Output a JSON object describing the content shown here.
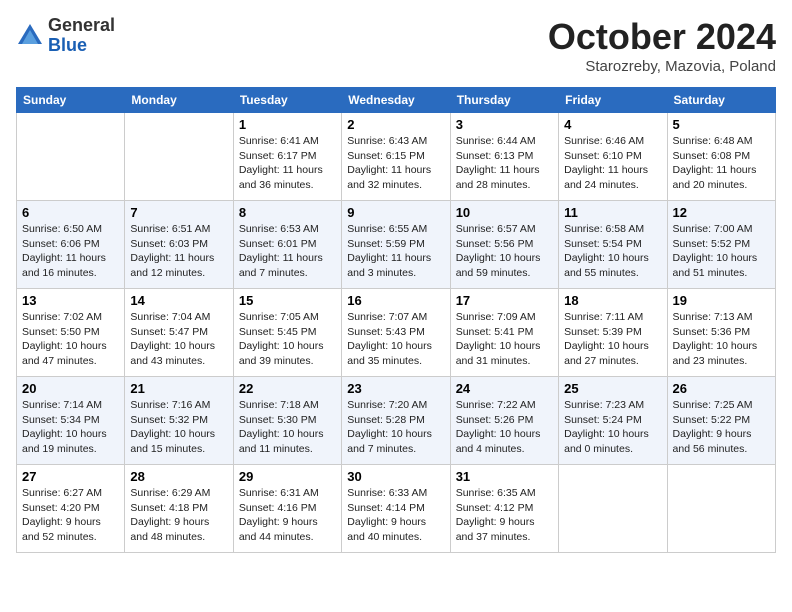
{
  "header": {
    "logo_general": "General",
    "logo_blue": "Blue",
    "title": "October 2024",
    "location": "Starozreby, Mazovia, Poland"
  },
  "days_of_week": [
    "Sunday",
    "Monday",
    "Tuesday",
    "Wednesday",
    "Thursday",
    "Friday",
    "Saturday"
  ],
  "weeks": [
    [
      {
        "day": "",
        "info": ""
      },
      {
        "day": "",
        "info": ""
      },
      {
        "day": "1",
        "info": "Sunrise: 6:41 AM\nSunset: 6:17 PM\nDaylight: 11 hours\nand 36 minutes."
      },
      {
        "day": "2",
        "info": "Sunrise: 6:43 AM\nSunset: 6:15 PM\nDaylight: 11 hours\nand 32 minutes."
      },
      {
        "day": "3",
        "info": "Sunrise: 6:44 AM\nSunset: 6:13 PM\nDaylight: 11 hours\nand 28 minutes."
      },
      {
        "day": "4",
        "info": "Sunrise: 6:46 AM\nSunset: 6:10 PM\nDaylight: 11 hours\nand 24 minutes."
      },
      {
        "day": "5",
        "info": "Sunrise: 6:48 AM\nSunset: 6:08 PM\nDaylight: 11 hours\nand 20 minutes."
      }
    ],
    [
      {
        "day": "6",
        "info": "Sunrise: 6:50 AM\nSunset: 6:06 PM\nDaylight: 11 hours\nand 16 minutes."
      },
      {
        "day": "7",
        "info": "Sunrise: 6:51 AM\nSunset: 6:03 PM\nDaylight: 11 hours\nand 12 minutes."
      },
      {
        "day": "8",
        "info": "Sunrise: 6:53 AM\nSunset: 6:01 PM\nDaylight: 11 hours\nand 7 minutes."
      },
      {
        "day": "9",
        "info": "Sunrise: 6:55 AM\nSunset: 5:59 PM\nDaylight: 11 hours\nand 3 minutes."
      },
      {
        "day": "10",
        "info": "Sunrise: 6:57 AM\nSunset: 5:56 PM\nDaylight: 10 hours\nand 59 minutes."
      },
      {
        "day": "11",
        "info": "Sunrise: 6:58 AM\nSunset: 5:54 PM\nDaylight: 10 hours\nand 55 minutes."
      },
      {
        "day": "12",
        "info": "Sunrise: 7:00 AM\nSunset: 5:52 PM\nDaylight: 10 hours\nand 51 minutes."
      }
    ],
    [
      {
        "day": "13",
        "info": "Sunrise: 7:02 AM\nSunset: 5:50 PM\nDaylight: 10 hours\nand 47 minutes."
      },
      {
        "day": "14",
        "info": "Sunrise: 7:04 AM\nSunset: 5:47 PM\nDaylight: 10 hours\nand 43 minutes."
      },
      {
        "day": "15",
        "info": "Sunrise: 7:05 AM\nSunset: 5:45 PM\nDaylight: 10 hours\nand 39 minutes."
      },
      {
        "day": "16",
        "info": "Sunrise: 7:07 AM\nSunset: 5:43 PM\nDaylight: 10 hours\nand 35 minutes."
      },
      {
        "day": "17",
        "info": "Sunrise: 7:09 AM\nSunset: 5:41 PM\nDaylight: 10 hours\nand 31 minutes."
      },
      {
        "day": "18",
        "info": "Sunrise: 7:11 AM\nSunset: 5:39 PM\nDaylight: 10 hours\nand 27 minutes."
      },
      {
        "day": "19",
        "info": "Sunrise: 7:13 AM\nSunset: 5:36 PM\nDaylight: 10 hours\nand 23 minutes."
      }
    ],
    [
      {
        "day": "20",
        "info": "Sunrise: 7:14 AM\nSunset: 5:34 PM\nDaylight: 10 hours\nand 19 minutes."
      },
      {
        "day": "21",
        "info": "Sunrise: 7:16 AM\nSunset: 5:32 PM\nDaylight: 10 hours\nand 15 minutes."
      },
      {
        "day": "22",
        "info": "Sunrise: 7:18 AM\nSunset: 5:30 PM\nDaylight: 10 hours\nand 11 minutes."
      },
      {
        "day": "23",
        "info": "Sunrise: 7:20 AM\nSunset: 5:28 PM\nDaylight: 10 hours\nand 7 minutes."
      },
      {
        "day": "24",
        "info": "Sunrise: 7:22 AM\nSunset: 5:26 PM\nDaylight: 10 hours\nand 4 minutes."
      },
      {
        "day": "25",
        "info": "Sunrise: 7:23 AM\nSunset: 5:24 PM\nDaylight: 10 hours\nand 0 minutes."
      },
      {
        "day": "26",
        "info": "Sunrise: 7:25 AM\nSunset: 5:22 PM\nDaylight: 9 hours\nand 56 minutes."
      }
    ],
    [
      {
        "day": "27",
        "info": "Sunrise: 6:27 AM\nSunset: 4:20 PM\nDaylight: 9 hours\nand 52 minutes."
      },
      {
        "day": "28",
        "info": "Sunrise: 6:29 AM\nSunset: 4:18 PM\nDaylight: 9 hours\nand 48 minutes."
      },
      {
        "day": "29",
        "info": "Sunrise: 6:31 AM\nSunset: 4:16 PM\nDaylight: 9 hours\nand 44 minutes."
      },
      {
        "day": "30",
        "info": "Sunrise: 6:33 AM\nSunset: 4:14 PM\nDaylight: 9 hours\nand 40 minutes."
      },
      {
        "day": "31",
        "info": "Sunrise: 6:35 AM\nSunset: 4:12 PM\nDaylight: 9 hours\nand 37 minutes."
      },
      {
        "day": "",
        "info": ""
      },
      {
        "day": "",
        "info": ""
      }
    ]
  ]
}
